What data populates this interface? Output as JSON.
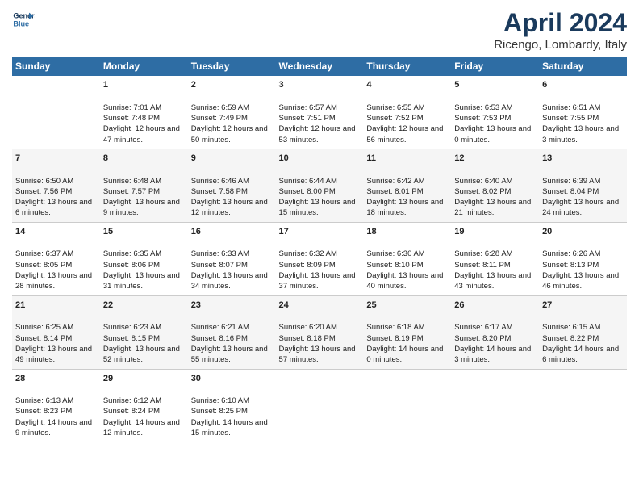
{
  "header": {
    "logo_line1": "General",
    "logo_line2": "Blue",
    "title": "April 2024",
    "subtitle": "Ricengo, Lombardy, Italy"
  },
  "weekdays": [
    "Sunday",
    "Monday",
    "Tuesday",
    "Wednesday",
    "Thursday",
    "Friday",
    "Saturday"
  ],
  "weeks": [
    [
      {
        "day": "",
        "sunrise": "",
        "sunset": "",
        "daylight": ""
      },
      {
        "day": "1",
        "sunrise": "Sunrise: 7:01 AM",
        "sunset": "Sunset: 7:48 PM",
        "daylight": "Daylight: 12 hours and 47 minutes."
      },
      {
        "day": "2",
        "sunrise": "Sunrise: 6:59 AM",
        "sunset": "Sunset: 7:49 PM",
        "daylight": "Daylight: 12 hours and 50 minutes."
      },
      {
        "day": "3",
        "sunrise": "Sunrise: 6:57 AM",
        "sunset": "Sunset: 7:51 PM",
        "daylight": "Daylight: 12 hours and 53 minutes."
      },
      {
        "day": "4",
        "sunrise": "Sunrise: 6:55 AM",
        "sunset": "Sunset: 7:52 PM",
        "daylight": "Daylight: 12 hours and 56 minutes."
      },
      {
        "day": "5",
        "sunrise": "Sunrise: 6:53 AM",
        "sunset": "Sunset: 7:53 PM",
        "daylight": "Daylight: 13 hours and 0 minutes."
      },
      {
        "day": "6",
        "sunrise": "Sunrise: 6:51 AM",
        "sunset": "Sunset: 7:55 PM",
        "daylight": "Daylight: 13 hours and 3 minutes."
      }
    ],
    [
      {
        "day": "7",
        "sunrise": "Sunrise: 6:50 AM",
        "sunset": "Sunset: 7:56 PM",
        "daylight": "Daylight: 13 hours and 6 minutes."
      },
      {
        "day": "8",
        "sunrise": "Sunrise: 6:48 AM",
        "sunset": "Sunset: 7:57 PM",
        "daylight": "Daylight: 13 hours and 9 minutes."
      },
      {
        "day": "9",
        "sunrise": "Sunrise: 6:46 AM",
        "sunset": "Sunset: 7:58 PM",
        "daylight": "Daylight: 13 hours and 12 minutes."
      },
      {
        "day": "10",
        "sunrise": "Sunrise: 6:44 AM",
        "sunset": "Sunset: 8:00 PM",
        "daylight": "Daylight: 13 hours and 15 minutes."
      },
      {
        "day": "11",
        "sunrise": "Sunrise: 6:42 AM",
        "sunset": "Sunset: 8:01 PM",
        "daylight": "Daylight: 13 hours and 18 minutes."
      },
      {
        "day": "12",
        "sunrise": "Sunrise: 6:40 AM",
        "sunset": "Sunset: 8:02 PM",
        "daylight": "Daylight: 13 hours and 21 minutes."
      },
      {
        "day": "13",
        "sunrise": "Sunrise: 6:39 AM",
        "sunset": "Sunset: 8:04 PM",
        "daylight": "Daylight: 13 hours and 24 minutes."
      }
    ],
    [
      {
        "day": "14",
        "sunrise": "Sunrise: 6:37 AM",
        "sunset": "Sunset: 8:05 PM",
        "daylight": "Daylight: 13 hours and 28 minutes."
      },
      {
        "day": "15",
        "sunrise": "Sunrise: 6:35 AM",
        "sunset": "Sunset: 8:06 PM",
        "daylight": "Daylight: 13 hours and 31 minutes."
      },
      {
        "day": "16",
        "sunrise": "Sunrise: 6:33 AM",
        "sunset": "Sunset: 8:07 PM",
        "daylight": "Daylight: 13 hours and 34 minutes."
      },
      {
        "day": "17",
        "sunrise": "Sunrise: 6:32 AM",
        "sunset": "Sunset: 8:09 PM",
        "daylight": "Daylight: 13 hours and 37 minutes."
      },
      {
        "day": "18",
        "sunrise": "Sunrise: 6:30 AM",
        "sunset": "Sunset: 8:10 PM",
        "daylight": "Daylight: 13 hours and 40 minutes."
      },
      {
        "day": "19",
        "sunrise": "Sunrise: 6:28 AM",
        "sunset": "Sunset: 8:11 PM",
        "daylight": "Daylight: 13 hours and 43 minutes."
      },
      {
        "day": "20",
        "sunrise": "Sunrise: 6:26 AM",
        "sunset": "Sunset: 8:13 PM",
        "daylight": "Daylight: 13 hours and 46 minutes."
      }
    ],
    [
      {
        "day": "21",
        "sunrise": "Sunrise: 6:25 AM",
        "sunset": "Sunset: 8:14 PM",
        "daylight": "Daylight: 13 hours and 49 minutes."
      },
      {
        "day": "22",
        "sunrise": "Sunrise: 6:23 AM",
        "sunset": "Sunset: 8:15 PM",
        "daylight": "Daylight: 13 hours and 52 minutes."
      },
      {
        "day": "23",
        "sunrise": "Sunrise: 6:21 AM",
        "sunset": "Sunset: 8:16 PM",
        "daylight": "Daylight: 13 hours and 55 minutes."
      },
      {
        "day": "24",
        "sunrise": "Sunrise: 6:20 AM",
        "sunset": "Sunset: 8:18 PM",
        "daylight": "Daylight: 13 hours and 57 minutes."
      },
      {
        "day": "25",
        "sunrise": "Sunrise: 6:18 AM",
        "sunset": "Sunset: 8:19 PM",
        "daylight": "Daylight: 14 hours and 0 minutes."
      },
      {
        "day": "26",
        "sunrise": "Sunrise: 6:17 AM",
        "sunset": "Sunset: 8:20 PM",
        "daylight": "Daylight: 14 hours and 3 minutes."
      },
      {
        "day": "27",
        "sunrise": "Sunrise: 6:15 AM",
        "sunset": "Sunset: 8:22 PM",
        "daylight": "Daylight: 14 hours and 6 minutes."
      }
    ],
    [
      {
        "day": "28",
        "sunrise": "Sunrise: 6:13 AM",
        "sunset": "Sunset: 8:23 PM",
        "daylight": "Daylight: 14 hours and 9 minutes."
      },
      {
        "day": "29",
        "sunrise": "Sunrise: 6:12 AM",
        "sunset": "Sunset: 8:24 PM",
        "daylight": "Daylight: 14 hours and 12 minutes."
      },
      {
        "day": "30",
        "sunrise": "Sunrise: 6:10 AM",
        "sunset": "Sunset: 8:25 PM",
        "daylight": "Daylight: 14 hours and 15 minutes."
      },
      {
        "day": "",
        "sunrise": "",
        "sunset": "",
        "daylight": ""
      },
      {
        "day": "",
        "sunrise": "",
        "sunset": "",
        "daylight": ""
      },
      {
        "day": "",
        "sunrise": "",
        "sunset": "",
        "daylight": ""
      },
      {
        "day": "",
        "sunrise": "",
        "sunset": "",
        "daylight": ""
      }
    ]
  ]
}
